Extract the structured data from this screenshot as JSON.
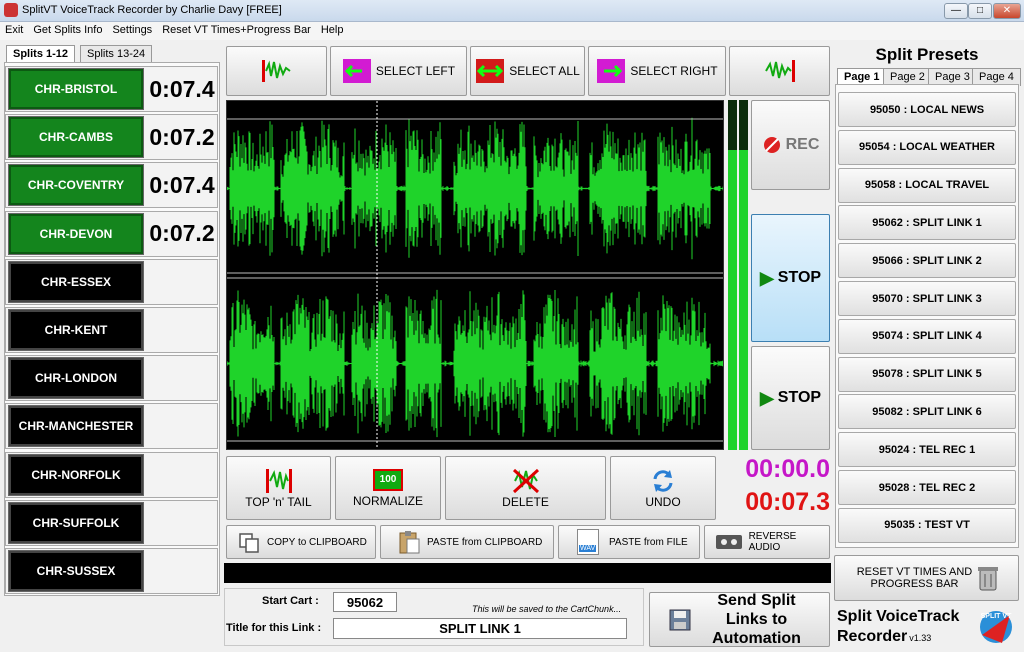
{
  "window": {
    "title": "SplitVT VoiceTrack Recorder by Charlie Davy     [FREE]"
  },
  "menu": [
    "Exit",
    "Get Splits Info",
    "Settings",
    "Reset VT Times+Progress Bar",
    "Help"
  ],
  "split_tabs": [
    "Splits 1-12",
    "Splits 13-24"
  ],
  "splits": [
    {
      "name": "CHR-BRISTOL",
      "time": "0:07.4",
      "active": true
    },
    {
      "name": "CHR-CAMBS",
      "time": "0:07.2",
      "active": true
    },
    {
      "name": "CHR-COVENTRY",
      "time": "0:07.4",
      "active": true
    },
    {
      "name": "CHR-DEVON",
      "time": "0:07.2",
      "active": true
    },
    {
      "name": "CHR-ESSEX",
      "time": "",
      "active": false
    },
    {
      "name": "CHR-KENT",
      "time": "",
      "active": false
    },
    {
      "name": "CHR-LONDON",
      "time": "",
      "active": false
    },
    {
      "name": "CHR-MANCHESTER",
      "time": "",
      "active": false
    },
    {
      "name": "CHR-NORFOLK",
      "time": "",
      "active": false
    },
    {
      "name": "CHR-SUFFOLK",
      "time": "",
      "active": false
    },
    {
      "name": "CHR-SUSSEX",
      "time": "",
      "active": false
    }
  ],
  "toolbar": {
    "select_left": "SELECT LEFT",
    "select_all": "SELECT ALL",
    "select_right": "SELECT RIGHT"
  },
  "transport": {
    "rec": "REC",
    "stop1": "STOP",
    "stop2": "STOP"
  },
  "edit": {
    "top_tail": "TOP 'n' TAIL",
    "normalize": "NORMALIZE",
    "delete": "DELETE",
    "undo": "UNDO"
  },
  "clip": {
    "copy": "COPY to CLIPBOARD",
    "paste_clip": "PASTE from CLIPBOARD",
    "paste_file": "PASTE from FILE",
    "reverse": "REVERSE AUDIO"
  },
  "timers": {
    "position": "00:00.0",
    "length": "00:07.3",
    "normalize_icon_text": "100",
    "wav_icon_text": "WAV"
  },
  "form": {
    "start_cart_label": "Start Cart :",
    "start_cart": "95062",
    "title_label": "Title for this Link :",
    "title_value": "SPLIT LINK 1",
    "note": "This will be saved to the CartChunk..."
  },
  "send": {
    "label": "Send Split Links to Automation"
  },
  "presets": {
    "heading": "Split Presets",
    "pages": [
      "Page 1",
      "Page 2",
      "Page 3",
      "Page 4"
    ],
    "items": [
      "95050 : LOCAL NEWS",
      "95054 : LOCAL WEATHER",
      "95058 : LOCAL TRAVEL",
      "95062 : SPLIT LINK 1",
      "95066 : SPLIT LINK 2",
      "95070 : SPLIT LINK 3",
      "95074 : SPLIT LINK 4",
      "95078 : SPLIT LINK 5",
      "95082 : SPLIT LINK 6",
      "95024 : TEL REC 1",
      "95028 : TEL REC 2",
      "95035 : TEST VT"
    ]
  },
  "reset": {
    "label": "RESET VT TIMES AND PROGRESS BAR"
  },
  "brand": {
    "name": "Split VoiceTrack Recorder",
    "version": "v1.33",
    "logo_text": "SPLIT VT"
  },
  "colors": {
    "accent_green": "#14851d",
    "wave_green": "#1fd32a",
    "timer_pos": "#c517c8",
    "timer_len": "#e01414"
  }
}
